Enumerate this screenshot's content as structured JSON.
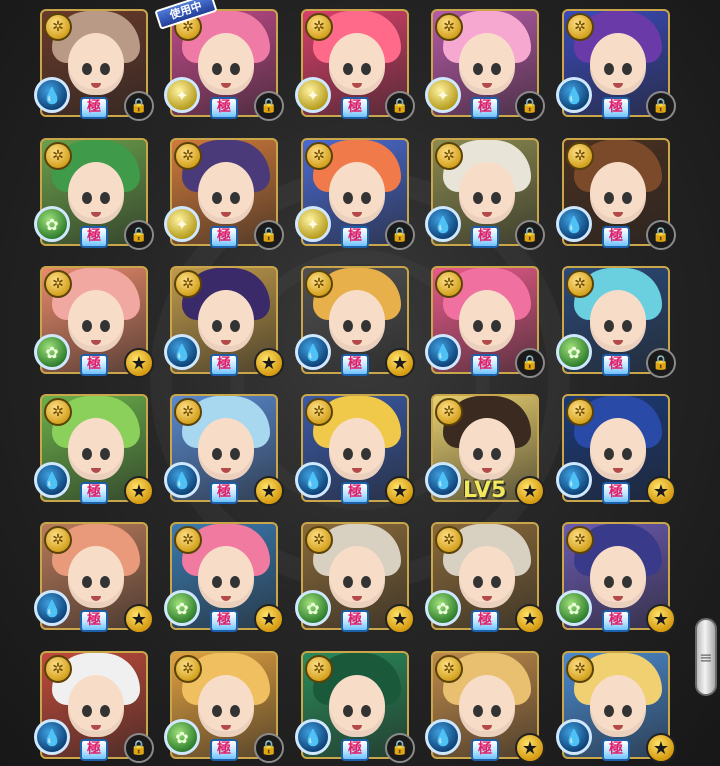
{
  "cards": [
    {
      "element": "water",
      "element_glyph": "💧",
      "hair": "#b89a86",
      "bg": "#6a3a2a",
      "gokuu": "極",
      "corner": "lock",
      "in_use": false,
      "level": ""
    },
    {
      "element": "light",
      "element_glyph": "✦",
      "hair": "#f07aa6",
      "bg": "#c04a8a",
      "gokuu": "極",
      "corner": "lock",
      "in_use": true,
      "level": ""
    },
    {
      "element": "light",
      "element_glyph": "✦",
      "hair": "#ff6a8a",
      "bg": "#d8406a",
      "gokuu": "極",
      "corner": "lock",
      "in_use": false,
      "level": ""
    },
    {
      "element": "light",
      "element_glyph": "✦",
      "hair": "#f6a8d0",
      "bg": "#b65aa8",
      "gokuu": "極",
      "corner": "lock",
      "in_use": false,
      "level": ""
    },
    {
      "element": "water",
      "element_glyph": "💧",
      "hair": "#6a3aa8",
      "bg": "#3a4ab8",
      "gokuu": "極",
      "corner": "lock",
      "in_use": false,
      "level": ""
    },
    {
      "element": "wood",
      "element_glyph": "✿",
      "hair": "#3f9a4a",
      "bg": "#6aa04a",
      "gokuu": "極",
      "corner": "lock",
      "in_use": false,
      "level": ""
    },
    {
      "element": "light",
      "element_glyph": "✦",
      "hair": "#4a3a7a",
      "bg": "#d07a3a",
      "gokuu": "極",
      "corner": "lock",
      "in_use": false,
      "level": ""
    },
    {
      "element": "light",
      "element_glyph": "✦",
      "hair": "#f07a4a",
      "bg": "#4a6ad0",
      "gokuu": "極",
      "corner": "lock",
      "in_use": false,
      "level": ""
    },
    {
      "element": "water",
      "element_glyph": "💧",
      "hair": "#e8e4d8",
      "bg": "#8a8a50",
      "gokuu": "極",
      "corner": "lock",
      "in_use": false,
      "level": ""
    },
    {
      "element": "water",
      "element_glyph": "💧",
      "hair": "#7a4a2a",
      "bg": "#4a3020",
      "gokuu": "極",
      "corner": "lock",
      "in_use": false,
      "level": ""
    },
    {
      "element": "wood",
      "element_glyph": "✿",
      "hair": "#f0a8a0",
      "bg": "#e88a6a",
      "gokuu": "極",
      "corner": "star",
      "in_use": false,
      "level": ""
    },
    {
      "element": "water",
      "element_glyph": "💧",
      "hair": "#3a2a6a",
      "bg": "#c09a4a",
      "gokuu": "極",
      "corner": "star",
      "in_use": false,
      "level": ""
    },
    {
      "element": "water",
      "element_glyph": "💧",
      "hair": "#e8b04a",
      "bg": "#505050",
      "gokuu": "極",
      "corner": "star",
      "in_use": false,
      "level": ""
    },
    {
      "element": "water",
      "element_glyph": "💧",
      "hair": "#f070a0",
      "bg": "#e85a8a",
      "gokuu": "極",
      "corner": "lock",
      "in_use": false,
      "level": ""
    },
    {
      "element": "wood",
      "element_glyph": "✿",
      "hair": "#6ad0e0",
      "bg": "#2a4a7a",
      "gokuu": "極",
      "corner": "lock",
      "in_use": false,
      "level": ""
    },
    {
      "element": "water",
      "element_glyph": "💧",
      "hair": "#8ad05a",
      "bg": "#6ab04a",
      "gokuu": "極",
      "corner": "star",
      "in_use": false,
      "level": ""
    },
    {
      "element": "water",
      "element_glyph": "💧",
      "hair": "#a8d8f0",
      "bg": "#5a8ad0",
      "gokuu": "極",
      "corner": "star",
      "in_use": false,
      "level": ""
    },
    {
      "element": "water",
      "element_glyph": "💧",
      "hair": "#f0c84a",
      "bg": "#3a5aa8",
      "gokuu": "極",
      "corner": "star",
      "in_use": false,
      "level": ""
    },
    {
      "element": "water",
      "element_glyph": "💧",
      "hair": "#3a2a20",
      "bg": "#e8d070",
      "gokuu": "",
      "corner": "star",
      "in_use": false,
      "level": "LV5"
    },
    {
      "element": "water",
      "element_glyph": "💧",
      "hair": "#2a4aa8",
      "bg": "#1a3a7a",
      "gokuu": "極",
      "corner": "star",
      "in_use": false,
      "level": ""
    },
    {
      "element": "water",
      "element_glyph": "💧",
      "hair": "#e89a7a",
      "bg": "#b87a5a",
      "gokuu": "極",
      "corner": "star",
      "in_use": false,
      "level": ""
    },
    {
      "element": "wood",
      "element_glyph": "✿",
      "hair": "#f07aa0",
      "bg": "#3a7ab0",
      "gokuu": "極",
      "corner": "star",
      "in_use": false,
      "level": ""
    },
    {
      "element": "wood",
      "element_glyph": "✿",
      "hair": "#d8d0c0",
      "bg": "#8a6a3a",
      "gokuu": "極",
      "corner": "star",
      "in_use": false,
      "level": ""
    },
    {
      "element": "wood",
      "element_glyph": "✿",
      "hair": "#d8d0c0",
      "bg": "#8a6a3a",
      "gokuu": "極",
      "corner": "star",
      "in_use": false,
      "level": ""
    },
    {
      "element": "wood",
      "element_glyph": "✿",
      "hair": "#3a3a8a",
      "bg": "#6a5ab0",
      "gokuu": "極",
      "corner": "star",
      "in_use": false,
      "level": ""
    },
    {
      "element": "water",
      "element_glyph": "💧",
      "hair": "#f0f0f0",
      "bg": "#c04a3a",
      "gokuu": "極",
      "corner": "lock",
      "in_use": false,
      "level": ""
    },
    {
      "element": "wood",
      "element_glyph": "✿",
      "hair": "#f0c060",
      "bg": "#e0a040",
      "gokuu": "極",
      "corner": "lock",
      "in_use": false,
      "level": ""
    },
    {
      "element": "water",
      "element_glyph": "💧",
      "hair": "#1a5a3a",
      "bg": "#2a8a5a",
      "gokuu": "極",
      "corner": "lock",
      "in_use": false,
      "level": ""
    },
    {
      "element": "water",
      "element_glyph": "💧",
      "hair": "#e8c070",
      "bg": "#c08a4a",
      "gokuu": "極",
      "corner": "star",
      "in_use": false,
      "level": ""
    },
    {
      "element": "water",
      "element_glyph": "💧",
      "hair": "#f0d070",
      "bg": "#4a8ad0",
      "gokuu": "極",
      "corner": "star",
      "in_use": false,
      "level": ""
    }
  ],
  "in_use_label": "使用中",
  "rank_badge_glyph": "✲",
  "lock_glyph": "🔒",
  "star_glyph": "★",
  "scroll_glyph": "≡"
}
